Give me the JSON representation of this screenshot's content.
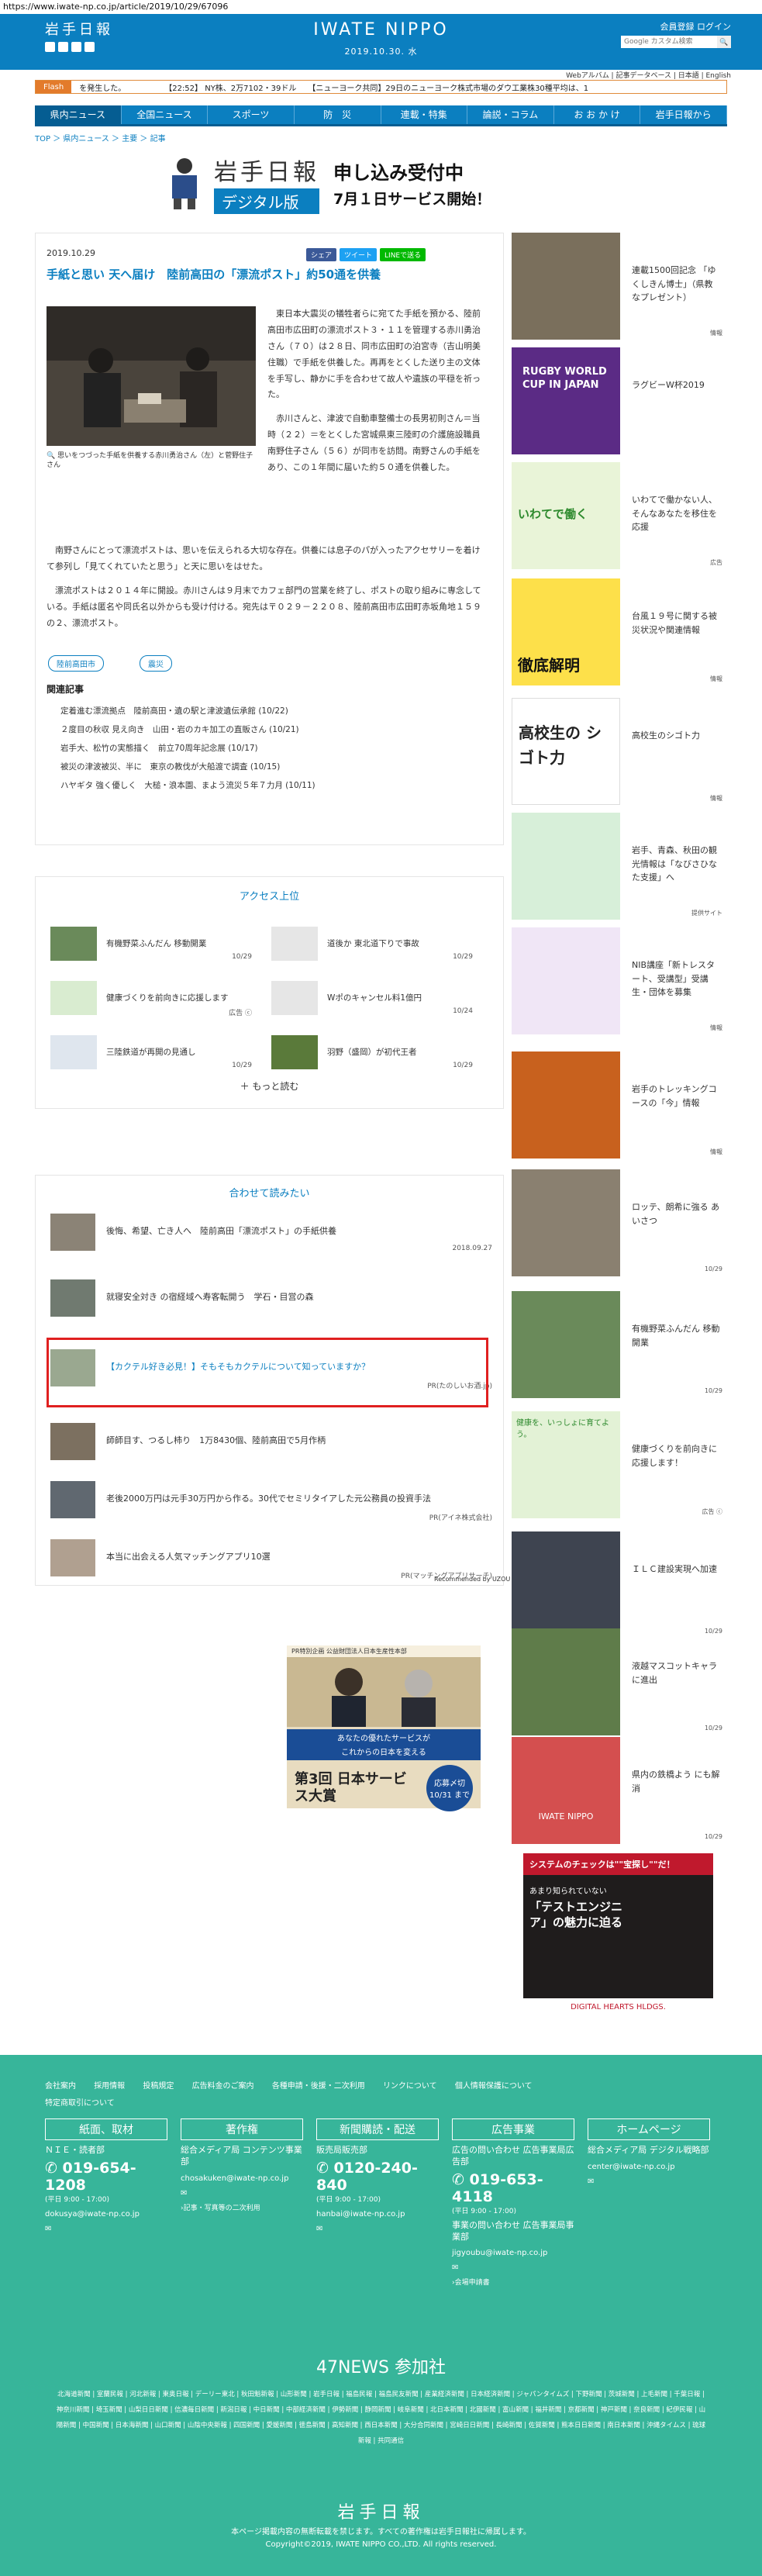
{
  "url": "https://www.iwate-np.co.jp/article/2019/10/29/67096",
  "header": {
    "logo": "岩手日報",
    "brand": "IWATE NIPPO",
    "date": "2019.10.30. 水",
    "member": "会員登録",
    "login": "ログイン",
    "search_placeholder": "Google カスタム検索"
  },
  "subnav": "Webアルバム | 記事データベース | 日本語 | English",
  "flash": {
    "tag": "Flash",
    "text": "を発生した。　　　　　　【22:52】 NY株、2万7102・39ドル　　【ニューヨーク共同】29日のニューヨーク株式市場のダウ工業株30種平均は、1"
  },
  "gnav": [
    "県内ニュース",
    "全国ニュース",
    "スポーツ",
    "防　災",
    "連載・特集",
    "論説・コラム",
    "お お か け",
    "岩手日報から"
  ],
  "breadcrumb": "TOP ＞ 県内ニュース ＞ 主要 ＞ 記事",
  "banner": {
    "brand": "岩手日報",
    "sub": "デジタル版",
    "line1": "申し込み受付中",
    "line2": "7月１日サービス開始！"
  },
  "article": {
    "date": "2019.10.29",
    "share_fb": "シェア",
    "share_tw": "ツイート",
    "share_line": "LINEで送る",
    "title": "手紙と思い 天へ届け　陸前高田の「漂流ポスト」約50通を供養",
    "caption": "思いをつづった手紙を供養する赤川勇治さん（左）と菅野住子さん",
    "body1": "　東日本大震災の犠牲者らに宛てた手紙を預かる、陸前高田市広田町の漂流ポスト３・１１を管理する赤川勇治さん（７０）は２８日、同市広田町の泊宮寺（吉山明美住職）で手紙を供養した。再再をとくした送り主の文体を手写し、静かに手を合わせて故人や遺族の平穏を祈った。",
    "body2": "　赤川さんと、津波で自動車整備士の長男初則さん＝当時（２２）＝をとくした宮城県東三陸町の介護施設職員南野住子さん（５６）が同市を訪問。南野さんの手紙をあり、この１年間に届いた約５０通を供養した。",
    "body3": "　南野さんにとって漂流ポストは、思いを伝えられる大切な存在。供養には息子のパが入ったアクセサリーを着けて参列し「見てくれていたと思う」と天に思いをはせた。",
    "body4": "　漂流ポストは２０１４年に開設。赤川さんは９月末でカフェ部門の営業を終了し、ポストの取り組みに専念している。手紙は匿名や同氏名以外からも受け付ける。宛先は〒０２９－２２０８、陸前高田市広田町赤坂角地１５９の２、漂流ポスト。",
    "tags": [
      "陸前高田市",
      "震災"
    ],
    "related_heading": "関連記事",
    "related": [
      "定着進む漂流拠点　陸前高田・遺の駅と津波遺伝承館 (10/22)",
      "２度目の秋収 見え向き　山田・岩のカキ加工の直販さん (10/21)",
      "岩手大、松竹の実態描く　前立70周年記念展 (10/17)",
      "被災の津波被災、半に　東京の教伐が大船渡で調査 (10/15)",
      "ハヤギタ 強く優しく　大槌・浪本園、まよう流災５年７力月 (10/11)"
    ]
  },
  "access": {
    "title": "アクセス上位",
    "items": [
      {
        "label": "有機野菜ふんだん 移動開業",
        "date": "10/29"
      },
      {
        "label": "道後か 東北道下りで事故",
        "date": "10/29"
      },
      {
        "label": "健康づくりを前向きに応援します",
        "date": "広告 ⓒ"
      },
      {
        "label": "Wポのキャンセル料1億円",
        "date": "10/24"
      },
      {
        "label": "三陸鉄道が再開の見通し",
        "date": "10/29"
      },
      {
        "label": "羽野（盛岡）が初代王者",
        "date": "10/29"
      }
    ],
    "more": "もっと読む"
  },
  "read": {
    "title": "合わせて読みたい",
    "items": [
      {
        "label": "後悔、希望、亡き人へ　陸前高田「漂流ポスト」の手紙供養",
        "meta": "2018.09.27"
      },
      {
        "label": "就寝安全対き の宿経域へ寿客転開う　学石・目営の森",
        "meta": ""
      },
      {
        "label": "【カクテル好き必見！】そもそもカクテルについて知っていますか？",
        "meta": "PR(たのしいお酒.jp)"
      },
      {
        "label": "師師目す、つるし柿り　1万8430個、陸前高田で5月作柄",
        "meta": ""
      },
      {
        "label": "老後2000万円は元手30万円から作る。30代でセミリタイアした元公務員の投資手法",
        "meta": "PR(アイネ株式会社)"
      },
      {
        "label": "本当に出会える人気マッチングアプリ10選",
        "meta": "PR(マッチングアプリサーチ)"
      }
    ],
    "powered": "Recommended by UZOU"
  },
  "promo": {
    "top": "PR特別企画 公益財団法人日本生産性本部",
    "text1": "あなたの優れたサービスが",
    "text2": "これからの日本を変える",
    "prize": "第3回 日本サービス大賞",
    "deadline": "応募〆切 10/31 まで"
  },
  "sidebar": [
    {
      "label": "連載1500回記念 「ゆくしきん博士」（県教なプレゼント）",
      "meta": "情報"
    },
    {
      "label": "ラグビーW杯2019",
      "meta": "",
      "art": "RUGBY WORLD CUP IN JAPAN"
    },
    {
      "label": "いわてで働かない人、そんなあなたを移住を応援",
      "meta": "広告",
      "art": "いわてで働く"
    },
    {
      "label": "台風１９号に関する被災状況や関連情報",
      "meta": "情報",
      "art": "徹底解明"
    },
    {
      "label": "高校生のシゴト力",
      "meta": "情報",
      "art": "高校生の シゴト力"
    },
    {
      "label": "岩手、青森、秋田の観光情報は「なびさひなた支援」へ",
      "meta": "提供サイト"
    },
    {
      "label": "NIB講座「新トレスタート、受講型」受講生・団体を募集",
      "meta": "情報"
    },
    {
      "label": "岩手のトレッキングコースの「今」情報",
      "meta": "情報"
    },
    {
      "label": "ロッテ、朗希に強る あいさつ",
      "meta": "10/29"
    },
    {
      "label": "有機野菜ふんだん 移動開業",
      "meta": "10/29"
    },
    {
      "label": "健康づくりを前向きに応援します！",
      "meta": "広告 ⓒ",
      "art": "健康を、いっしょに育てよう。"
    },
    {
      "label": "ＩＬＣ建設実現へ加速",
      "meta": "10/29"
    },
    {
      "label": "液越マスコットキャラに進出",
      "meta": "10/29"
    },
    {
      "label": "県内の鉄橋よう にも解消",
      "meta": "10/29",
      "art": "IWATE NIPPO"
    }
  ],
  "side_ad": {
    "top": "システムのチェックは\"\"宝探し\"\"だ！",
    "mid": "あまり知られていない",
    "big": "「テストエンジニア」の魅力に迫る",
    "brand": "DIGITAL HEARTS HLDGS."
  },
  "footer": {
    "links": [
      "会社案内",
      "採用情報",
      "投稿規定",
      "広告料金のご案内",
      "各種申請・後援・二次利用",
      "リンクについて",
      "個人情報保護について",
      "特定商取引について"
    ],
    "cols": [
      {
        "head": "紙面、取材",
        "t1": "ＮＩＥ・読者部",
        "tel": "019-654-1208",
        "small": "(平日 9:00 - 17:00)",
        "mail": "dokusya@iwate-np.co.jp",
        "extra": ""
      },
      {
        "head": "著作権",
        "t1": "総合メディア局 コンテンツ事業部",
        "tel": "",
        "small": "",
        "mail": "chosakuken@iwate-np.co.jp",
        "extra": "›記事・写真等の二次利用"
      },
      {
        "head": "新聞購読・配送",
        "t1": "販売局販売部",
        "tel": "0120-240-840",
        "small": "(平日 9:00 - 17:00)",
        "mail": "hanbai@iwate-np.co.jp",
        "extra": ""
      },
      {
        "head": "広告事業",
        "t1": "広告の問い合わせ 広告事業局広告部",
        "tel": "019-653-4118",
        "small": "(平日 9:00 - 17:00)",
        "mail": "jigyoubu@iwate-np.co.jp",
        "extra": "›会場申請書"
      },
      {
        "head": "ホームページ",
        "t1": "総合メディア局 デジタル戦略部",
        "tel": "",
        "small": "",
        "mail": "center@iwate-np.co.jp",
        "extra": ""
      }
    ],
    "jigyo": "事業の問い合わせ 広告事業局事業部",
    "news47": "47NEWS 参加社",
    "papers": "北海道新聞 | 室蘭民報 | 河北新報 | 東奥日報 | デーリー東北 | 秋田魁新報 | 山形新聞 | 岩手日報 | 福島民報 | 福島民友新聞 | 産業経済新聞 | 日本経済新聞 | ジャパンタイムズ | 下野新聞 | 茨城新聞 | 上毛新聞 | 千葉日報 | 神奈川新聞 | 埼玉新聞 | 山梨日日新聞 | 信濃毎日新聞 | 新潟日報 | 中日新聞 | 中部経済新聞 | 伊勢新聞 | 静岡新聞 | 岐阜新聞 | 北日本新聞 | 北國新聞 | 富山新聞 | 福井新聞 | 京都新聞 | 神戸新聞 | 奈良新聞 | 紀伊民報 | 山陽新聞 | 中国新聞 | 日本海新聞 | 山口新聞 | 山陰中央新報 | 四国新聞 | 愛媛新聞 | 徳島新聞 | 高知新聞 | 西日本新聞 | 大分合同新聞 | 宮崎日日新聞 | 長崎新聞 | 佐賀新聞 | 熊本日日新聞 | 南日本新聞 | 沖縄タイムス | 琉球新報 | 共同通信",
    "logo": "岩手日報",
    "note1": "本ページ掲載内容の無断転載を禁じます。すべての著作権は岩手日報社に帰属します。",
    "note2": "Copyright©2019, IWATE NIPPO CO.,LTD. All rights reserved."
  }
}
